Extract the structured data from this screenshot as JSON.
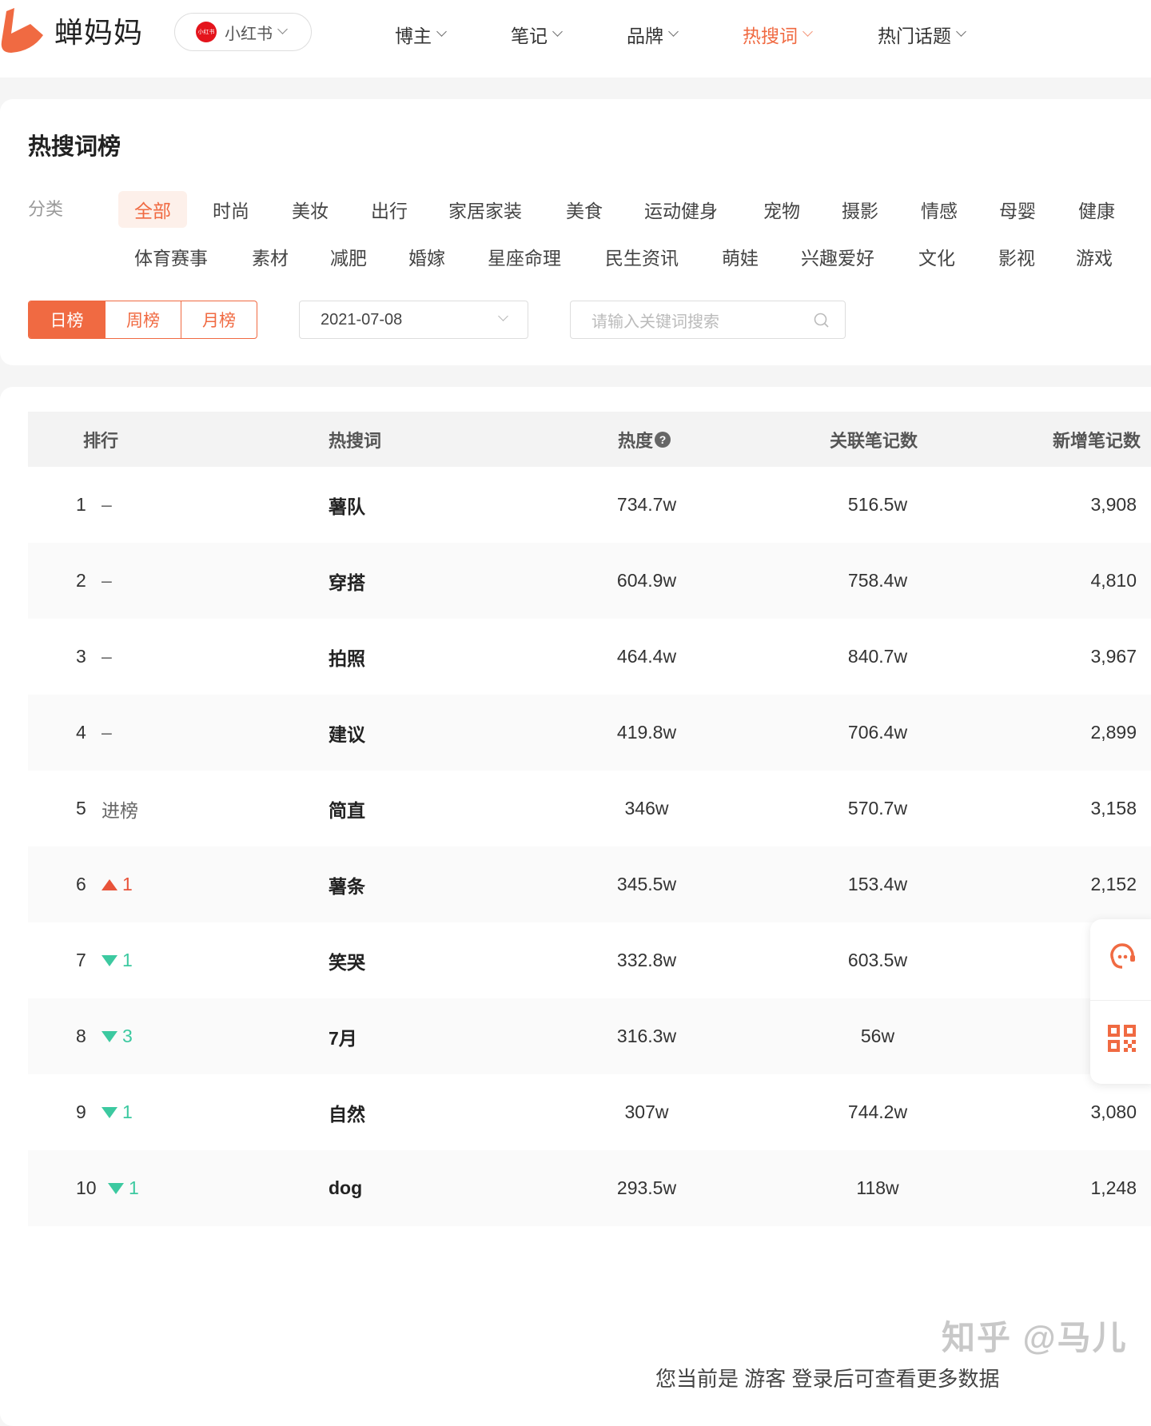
{
  "nav": {
    "brand": "蝉妈妈",
    "platform": "小红书",
    "platform_badge": "小红书",
    "menus": [
      "博主",
      "笔记",
      "品牌",
      "热搜词",
      "热门话题"
    ],
    "active_menu": "热搜词"
  },
  "panel": {
    "title": "热搜词榜",
    "category_label": "分类",
    "categories_row1": [
      "全部",
      "时尚",
      "美妆",
      "出行",
      "家居家装",
      "美食",
      "运动健身",
      "宠物",
      "摄影",
      "情感",
      "母婴",
      "健康"
    ],
    "categories_row2": [
      "体育赛事",
      "素材",
      "减肥",
      "婚嫁",
      "星座命理",
      "民生资讯",
      "萌娃",
      "兴趣爱好",
      "文化",
      "影视",
      "游戏"
    ],
    "active_category": "全部",
    "periods": [
      "日榜",
      "周榜",
      "月榜"
    ],
    "active_period": "日榜",
    "date": "2021-07-08",
    "search_placeholder": "请输入关键词搜索"
  },
  "table": {
    "headers": [
      "排行",
      "热搜词",
      "热度",
      "关联笔记数",
      "新增笔记数"
    ],
    "rows": [
      {
        "rank": "1",
        "trend": "flat",
        "change": "–",
        "keyword": "薯队",
        "heat": "734.7w",
        "notes": "516.5w",
        "new": "3,908"
      },
      {
        "rank": "2",
        "trend": "flat",
        "change": "–",
        "keyword": "穿搭",
        "heat": "604.9w",
        "notes": "758.4w",
        "new": "4,810"
      },
      {
        "rank": "3",
        "trend": "flat",
        "change": "–",
        "keyword": "拍照",
        "heat": "464.4w",
        "notes": "840.7w",
        "new": "3,967"
      },
      {
        "rank": "4",
        "trend": "flat",
        "change": "–",
        "keyword": "建议",
        "heat": "419.8w",
        "notes": "706.4w",
        "new": "2,899"
      },
      {
        "rank": "5",
        "trend": "new",
        "change": "进榜",
        "keyword": "简直",
        "heat": "346w",
        "notes": "570.7w",
        "new": "3,158"
      },
      {
        "rank": "6",
        "trend": "up",
        "change": "1",
        "keyword": "薯条",
        "heat": "345.5w",
        "notes": "153.4w",
        "new": "2,152"
      },
      {
        "rank": "7",
        "trend": "down",
        "change": "1",
        "keyword": "笑哭",
        "heat": "332.8w",
        "notes": "603.5w",
        "new": ""
      },
      {
        "rank": "8",
        "trend": "down",
        "change": "3",
        "keyword": "7月",
        "heat": "316.3w",
        "notes": "56w",
        "new": ""
      },
      {
        "rank": "9",
        "trend": "down",
        "change": "1",
        "keyword": "自然",
        "heat": "307w",
        "notes": "744.2w",
        "new": "3,080"
      },
      {
        "rank": "10",
        "trend": "down",
        "change": "1",
        "keyword": "dog",
        "heat": "293.5w",
        "notes": "118w",
        "new": "1,248"
      }
    ]
  },
  "watermark": "知乎 @马儿",
  "footer": "您当前是 游客 登录后可查看更多数据",
  "colors": {
    "accent": "#f06a42",
    "up": "#e8533a",
    "down": "#3cc9a0"
  }
}
